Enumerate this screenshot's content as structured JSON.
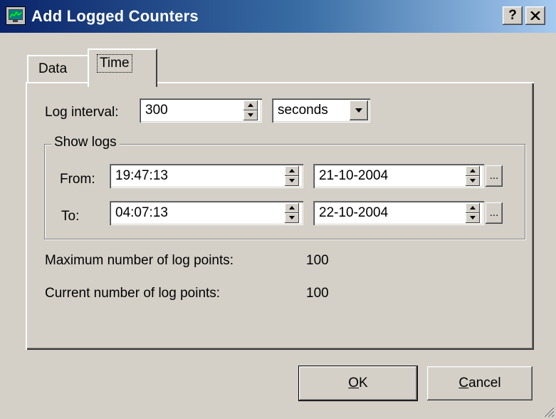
{
  "window": {
    "title": "Add Logged Counters",
    "help_button": "?",
    "close_button": "✕",
    "icon": "monitor-chart-icon"
  },
  "tabs": [
    {
      "label": "Data",
      "selected": false
    },
    {
      "label": "Time",
      "selected": true
    }
  ],
  "log_interval": {
    "label": "Log interval:",
    "value": "300",
    "unit": "seconds",
    "unit_options": [
      "seconds"
    ]
  },
  "show_logs": {
    "title": "Show logs",
    "from": {
      "label": "From:",
      "time": "19:47:13",
      "date": "21-10-2004",
      "picker_label": "..."
    },
    "to": {
      "label": "To:",
      "time": "04:07:13",
      "date": "22-10-2004",
      "picker_label": "..."
    }
  },
  "stats": {
    "max_label": "Maximum number of log points:",
    "max_value": "100",
    "current_label": "Current number of log points:",
    "current_value": "100"
  },
  "buttons": {
    "ok_first": "O",
    "ok_rest": "K",
    "cancel_first": "C",
    "cancel_rest": "ancel"
  },
  "colors": {
    "face": "#d4d0c8",
    "titlebar_start": "#0a246a",
    "titlebar_end": "#a6caf0"
  }
}
